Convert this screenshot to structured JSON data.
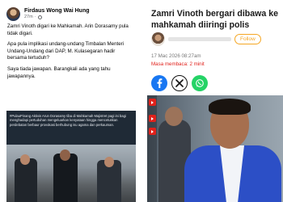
{
  "facebook_post": {
    "author": "Firdaus Wong Wai Hung",
    "time": "27m",
    "paragraphs": [
      "Zamri Vinoth digari ke Mahkamah. Arin Dorasamy pula tidak digari.",
      "Apa pula implikasi undang-undang Timbalan Menteri Undang-Undang dari DAP, M. Kulasegaran hadir bersama tertuduh?",
      "Saya tiada jawapan. Barangkali ada yang tahu jawapannya."
    ],
    "share_caption": "#PulauPinang Aktivis Arun Dorasamy tiba di Mahkamah Majistret pagi ini bagi menghadapi pertuduhan mengeluarkan kenyataan hingga mencetuskan perdebatan berbaur provokasi berhubung isu agama dan perkauman."
  },
  "article": {
    "headline": "Zamri Vinoth bergari dibawa ke mahkamah diiringi polis",
    "follow_label": "Follow",
    "datetime": "17 Mac 2026 08:27am",
    "read_time": "Masa membaca: 2 minit",
    "share_icons": [
      "facebook-icon",
      "x-icon",
      "whatsapp-icon"
    ]
  },
  "colors": {
    "facebook_blue": "#1877f2",
    "whatsapp_green": "#25d366",
    "follow_orange": "#f5a623",
    "read_time_red": "#e0211b",
    "suit_blue": "#2c4fc6"
  }
}
